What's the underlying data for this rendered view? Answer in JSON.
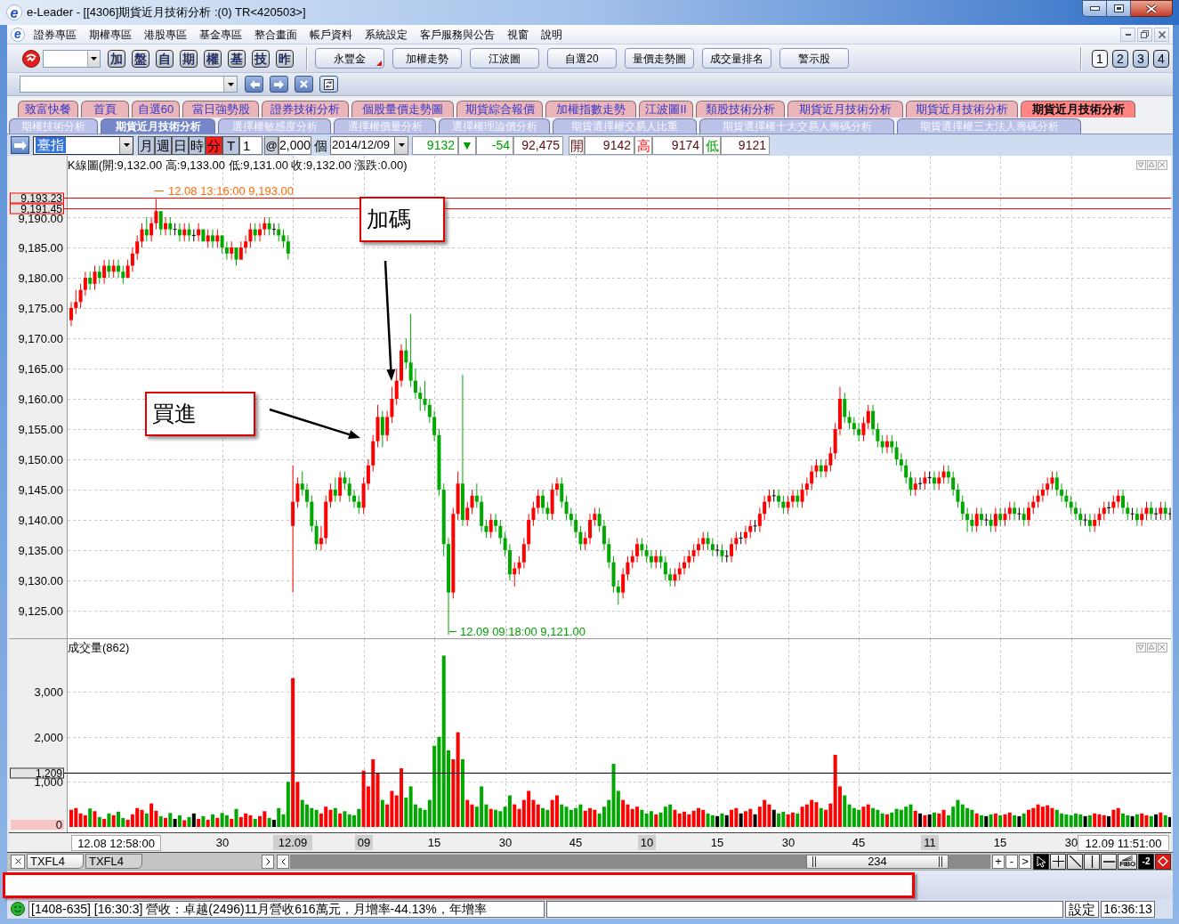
{
  "window": {
    "logo": "e",
    "title": "e-Leader - [[4306]期貨近月技術分析 :(0) TR<420503>]"
  },
  "menu": {
    "logo": "e",
    "items": [
      "證券專區",
      "期權專區",
      "港股專區",
      "基金專區",
      "整合畫面",
      "帳戶資料",
      "系統設定",
      "客戶服務與公告",
      "視窗",
      "說明"
    ]
  },
  "toolbar": {
    "quick_buttons": [
      "加",
      "盤",
      "自",
      "期",
      "權",
      "基",
      "技",
      "昨"
    ],
    "buttons": [
      {
        "label": "永豐金",
        "kind": "menu"
      },
      {
        "label": "加權走勢",
        "kind": "plain"
      },
      {
        "label": "江波圖",
        "kind": "plain"
      },
      {
        "label": "自選20",
        "kind": "plain"
      },
      {
        "label": "量價走勢圖",
        "kind": "plain"
      },
      {
        "label": "成交量排名",
        "kind": "plain"
      },
      {
        "label": "警示股",
        "kind": "plain"
      }
    ],
    "layouts": [
      {
        "label": "1",
        "selected": true
      },
      {
        "label": "2",
        "selected": false
      },
      {
        "label": "3",
        "selected": false
      },
      {
        "label": "4",
        "selected": false
      }
    ]
  },
  "tabs": [
    {
      "label": "致富快餐",
      "selected": false
    },
    {
      "label": "首頁",
      "selected": false
    },
    {
      "label": "自選60",
      "selected": false
    },
    {
      "label": "當日強勢股",
      "selected": false
    },
    {
      "label": "證券技術分析",
      "selected": false
    },
    {
      "label": "個股量價走勢圖",
      "selected": false
    },
    {
      "label": "期貨綜合報價",
      "selected": false
    },
    {
      "label": "加權指數走勢",
      "selected": false
    },
    {
      "label": "江波圖II",
      "selected": false
    },
    {
      "label": "類股技術分析",
      "selected": false
    },
    {
      "label": "期貨近月技術分析",
      "selected": false
    },
    {
      "label": "期貨近月技術分析",
      "selected": false
    },
    {
      "label": "期貨近月技術分析",
      "selected": true
    }
  ],
  "sub_tabs": [
    {
      "label": "期權技術分析",
      "selected": false
    },
    {
      "label": "期貨近月技術分析",
      "selected": true
    },
    {
      "label": "選擇權敏感度分析",
      "selected": false
    },
    {
      "label": "選擇權價量分析",
      "selected": false
    },
    {
      "label": "選擇權理論價分析",
      "selected": false
    },
    {
      "label": "期貨選擇權交易人比重",
      "selected": false
    },
    {
      "label": "期貨選擇權十大交易人籌碼分析",
      "selected": false
    },
    {
      "label": "期貨選擇權三大法人籌碼分析",
      "selected": false
    }
  ],
  "controls": {
    "symbol": "臺指",
    "periods": [
      {
        "label": "月",
        "selected": false
      },
      {
        "label": "週",
        "selected": false
      },
      {
        "label": "日",
        "selected": false
      },
      {
        "label": "時",
        "selected": false
      },
      {
        "label": "分",
        "selected": true
      },
      {
        "label": "T",
        "selected": false
      }
    ],
    "interval": "1",
    "at": "@",
    "count": "2,000",
    "unit": "個",
    "date": "2014/12/09"
  },
  "quote": {
    "down": true,
    "last": "9132",
    "arrow": "▼",
    "change": "-54",
    "volume": "92,475",
    "open_label": "開",
    "open": "9142",
    "high_label": "高",
    "high": "9174",
    "low_label": "低",
    "low": "9121"
  },
  "price_chart": {
    "title": "K線圖(開:9,132.00 高:9,133.00 低:9,131.00 收:9,132.00 漲跌:0.00)",
    "high_marker": "12.08 13:16:00 9,193.00",
    "low_marker": "12.09 09:18:00 9,121.00",
    "callouts": [
      "加碼",
      "買進"
    ],
    "chart_data": {
      "type": "candlestick",
      "grid": true,
      "ylim": [
        9120.3,
        9200.15
      ],
      "yticks": [
        {
          "value": 9190,
          "label": "9,190.00"
        },
        {
          "value": 9185,
          "label": "9,185.00"
        },
        {
          "value": 9180,
          "label": "9,180.00"
        },
        {
          "value": 9175,
          "label": "9,175.00"
        },
        {
          "value": 9170,
          "label": "9,170.00"
        },
        {
          "value": 9165,
          "label": "9,165.00"
        },
        {
          "value": 9160,
          "label": "9,160.00"
        },
        {
          "value": 9155,
          "label": "9,155.00"
        },
        {
          "value": 9150,
          "label": "9,150.00"
        },
        {
          "value": 9145,
          "label": "9,145.00"
        },
        {
          "value": 9140,
          "label": "9,140.00"
        },
        {
          "value": 9135,
          "label": "9,135.00"
        },
        {
          "value": 9130,
          "label": "9,130.00"
        },
        {
          "value": 9125,
          "label": "9,125.00"
        }
      ],
      "ref_lines": [
        {
          "axis": "y",
          "value": 9193.23,
          "label": "9,193.23"
        },
        {
          "axis": "y",
          "value": 9191.45,
          "label": "9,191.45"
        }
      ],
      "ohlc": [
        [
          9173,
          9176,
          9172,
          9175
        ],
        [
          9175,
          9178,
          9174,
          9176
        ],
        [
          9176,
          9179,
          9175,
          9178
        ],
        [
          9178,
          9181,
          9177,
          9180
        ],
        [
          9180,
          9181,
          9178,
          9179
        ],
        [
          9179,
          9182,
          9178,
          9181
        ],
        [
          9181,
          9182,
          9179,
          9180
        ],
        [
          9180,
          9183,
          9179,
          9182
        ],
        [
          9182,
          9183,
          9180,
          9181
        ],
        [
          9181,
          9183,
          9180,
          9182
        ],
        [
          9182,
          9183,
          9180,
          9181
        ],
        [
          9181,
          9182,
          9179,
          9180
        ],
        [
          9180,
          9183,
          9180,
          9182
        ],
        [
          9182,
          9185,
          9181,
          9184
        ],
        [
          9184,
          9187,
          9183,
          9186
        ],
        [
          9186,
          9189,
          9185,
          9188
        ],
        [
          9188,
          9190,
          9186,
          9187
        ],
        [
          9187,
          9190,
          9186,
          9189
        ],
        [
          9189,
          9193,
          9188,
          9191
        ],
        [
          9191,
          9191,
          9187,
          9188
        ],
        [
          9188,
          9190,
          9187,
          9189
        ],
        [
          9189,
          9190,
          9187,
          9188
        ],
        [
          9188,
          9189,
          9187,
          9188
        ],
        [
          9188,
          9189,
          9186,
          9187
        ],
        [
          9187,
          9189,
          9186,
          9188
        ],
        [
          9188,
          9189,
          9186,
          9187
        ],
        [
          9187,
          9188,
          9186,
          9187
        ],
        [
          9187,
          9189,
          9186,
          9188
        ],
        [
          9188,
          9188,
          9186,
          9186
        ],
        [
          9186,
          9188,
          9185,
          9187
        ],
        [
          9187,
          9188,
          9185,
          9186
        ],
        [
          9186,
          9188,
          9185,
          9187
        ],
        [
          9187,
          9187,
          9184,
          9185
        ],
        [
          9185,
          9186,
          9183,
          9184
        ],
        [
          9184,
          9186,
          9183,
          9185
        ],
        [
          9185,
          9185,
          9182,
          9183
        ],
        [
          9183,
          9186,
          9183,
          9185
        ],
        [
          9185,
          9187,
          9184,
          9186
        ],
        [
          9186,
          9189,
          9185,
          9188
        ],
        [
          9188,
          9189,
          9186,
          9187
        ],
        [
          9187,
          9189,
          9186,
          9188
        ],
        [
          9188,
          9190,
          9187,
          9189
        ],
        [
          9189,
          9190,
          9187,
          9188
        ],
        [
          9188,
          9189,
          9187,
          9188
        ],
        [
          9188,
          9189,
          9186,
          9187
        ],
        [
          9187,
          9188,
          9185,
          9186
        ],
        [
          9186,
          9187,
          9183,
          9184
        ],
        [
          9139,
          9149,
          9128,
          9143
        ],
        [
          9143,
          9147,
          9142,
          9146
        ],
        [
          9146,
          9148,
          9144,
          9145
        ],
        [
          9145,
          9146,
          9142,
          9143
        ],
        [
          9143,
          9144,
          9138,
          9139
        ],
        [
          9139,
          9140,
          9135,
          9136
        ],
        [
          9136,
          9139,
          9135,
          9137
        ],
        [
          9137,
          9144,
          9136,
          9143
        ],
        [
          9143,
          9146,
          9142,
          9145
        ],
        [
          9145,
          9147,
          9143,
          9144
        ],
        [
          9144,
          9148,
          9143,
          9147
        ],
        [
          9147,
          9148,
          9145,
          9146
        ],
        [
          9146,
          9147,
          9143,
          9144
        ],
        [
          9144,
          9145,
          9142,
          9143
        ],
        [
          9143,
          9144,
          9141,
          9142
        ],
        [
          9142,
          9147,
          9141,
          9146
        ],
        [
          9146,
          9150,
          9145,
          9149
        ],
        [
          9149,
          9154,
          9148,
          9153
        ],
        [
          9153,
          9159,
          9152,
          9157
        ],
        [
          9157,
          9158,
          9152,
          9154
        ],
        [
          9154,
          9158,
          9153,
          9157
        ],
        [
          9157,
          9162,
          9156,
          9160
        ],
        [
          9160,
          9165,
          9159,
          9163
        ],
        [
          9163,
          9169,
          9162,
          9168
        ],
        [
          9168,
          9170,
          9165,
          9166
        ],
        [
          9166,
          9174,
          9162,
          9163
        ],
        [
          9163,
          9165,
          9160,
          9161
        ],
        [
          9161,
          9162,
          9158,
          9160
        ],
        [
          9160,
          9163,
          9158,
          9159
        ],
        [
          9159,
          9160,
          9156,
          9157
        ],
        [
          9157,
          9158,
          9153,
          9154
        ],
        [
          9154,
          9155,
          9144,
          9145
        ],
        [
          9145,
          9146,
          9134,
          9136
        ],
        [
          9136,
          9137,
          9121,
          9128
        ],
        [
          9128,
          9142,
          9127,
          9141
        ],
        [
          9141,
          9148,
          9140,
          9146
        ],
        [
          9146,
          9164,
          9139,
          9140
        ],
        [
          9140,
          9143,
          9139,
          9142
        ],
        [
          9142,
          9145,
          9141,
          9144
        ],
        [
          9144,
          9146,
          9142,
          9143
        ],
        [
          9143,
          9144,
          9138,
          9139
        ],
        [
          9139,
          9140,
          9137,
          9138
        ],
        [
          9138,
          9141,
          9137,
          9140
        ],
        [
          9140,
          9141,
          9138,
          9139
        ],
        [
          9139,
          9140,
          9136,
          9137
        ],
        [
          9137,
          9138,
          9134,
          9135
        ],
        [
          9135,
          9136,
          9130,
          9131
        ],
        [
          9131,
          9133,
          9129,
          9132
        ],
        [
          9132,
          9134,
          9131,
          9133
        ],
        [
          9133,
          9137,
          9132,
          9136
        ],
        [
          9136,
          9141,
          9135,
          9140
        ],
        [
          9140,
          9143,
          9139,
          9142
        ],
        [
          9142,
          9145,
          9141,
          9144
        ],
        [
          9144,
          9145,
          9141,
          9142
        ],
        [
          9142,
          9143,
          9140,
          9141
        ],
        [
          9141,
          9146,
          9140,
          9145
        ],
        [
          9145,
          9147,
          9144,
          9146
        ],
        [
          9146,
          9147,
          9142,
          9143
        ],
        [
          9143,
          9144,
          9140,
          9141
        ],
        [
          9141,
          9142,
          9139,
          9140
        ],
        [
          9140,
          9141,
          9137,
          9138
        ],
        [
          9138,
          9139,
          9135,
          9136
        ],
        [
          9136,
          9138,
          9135,
          9137
        ],
        [
          9137,
          9141,
          9136,
          9140
        ],
        [
          9140,
          9142,
          9139,
          9141
        ],
        [
          9141,
          9142,
          9138,
          9139
        ],
        [
          9139,
          9140,
          9135,
          9136
        ],
        [
          9136,
          9137,
          9132,
          9133
        ],
        [
          9133,
          9134,
          9128,
          9129
        ],
        [
          9129,
          9130,
          9126,
          9128
        ],
        [
          9128,
          9132,
          9127,
          9131
        ],
        [
          9131,
          9134,
          9130,
          9133
        ],
        [
          9133,
          9135,
          9132,
          9134
        ],
        [
          9134,
          9137,
          9133,
          9136
        ],
        [
          9136,
          9137,
          9134,
          9135
        ],
        [
          9135,
          9136,
          9133,
          9134
        ],
        [
          9134,
          9135,
          9132,
          9133
        ],
        [
          9133,
          9135,
          9132,
          9134
        ],
        [
          9134,
          9135,
          9132,
          9133
        ],
        [
          9133,
          9134,
          9130,
          9131
        ],
        [
          9131,
          9132,
          9129,
          9130
        ],
        [
          9130,
          9132,
          9129,
          9131
        ],
        [
          9131,
          9133,
          9130,
          9132
        ],
        [
          9132,
          9134,
          9131,
          9133
        ],
        [
          9133,
          9135,
          9132,
          9134
        ],
        [
          9134,
          9136,
          9133,
          9135
        ],
        [
          9135,
          9137,
          9134,
          9136
        ],
        [
          9136,
          9138,
          9135,
          9137
        ],
        [
          9137,
          9138,
          9135,
          9136
        ],
        [
          9136,
          9137,
          9134,
          9135
        ],
        [
          9135,
          9136,
          9134,
          9135
        ],
        [
          9135,
          9136,
          9133,
          9134
        ],
        [
          9134,
          9135,
          9133,
          9134
        ],
        [
          9134,
          9137,
          9133,
          9136
        ],
        [
          9136,
          9138,
          9135,
          9137
        ],
        [
          9137,
          9138,
          9136,
          9137
        ],
        [
          9137,
          9139,
          9136,
          9138
        ],
        [
          9138,
          9140,
          9137,
          9139
        ],
        [
          9139,
          9140,
          9138,
          9139
        ],
        [
          9139,
          9142,
          9138,
          9141
        ],
        [
          9141,
          9144,
          9140,
          9143
        ],
        [
          9143,
          9145,
          9142,
          9144
        ],
        [
          9144,
          9145,
          9143,
          9144
        ],
        [
          9144,
          9145,
          9142,
          9143
        ],
        [
          9143,
          9144,
          9141,
          9142
        ],
        [
          9142,
          9144,
          9141,
          9143
        ],
        [
          9143,
          9145,
          9142,
          9144
        ],
        [
          9144,
          9145,
          9142,
          9143
        ],
        [
          9143,
          9146,
          9142,
          9145
        ],
        [
          9145,
          9147,
          9144,
          9146
        ],
        [
          9146,
          9149,
          9145,
          9148
        ],
        [
          9148,
          9150,
          9147,
          9149
        ],
        [
          9149,
          9150,
          9147,
          9148
        ],
        [
          9148,
          9150,
          9147,
          9149
        ],
        [
          9149,
          9152,
          9148,
          9151
        ],
        [
          9151,
          9156,
          9150,
          9155
        ],
        [
          9155,
          9162,
          9154,
          9160
        ],
        [
          9160,
          9161,
          9156,
          9157
        ],
        [
          9157,
          9158,
          9155,
          9156
        ],
        [
          9156,
          9157,
          9154,
          9155
        ],
        [
          9155,
          9156,
          9153,
          9154
        ],
        [
          9154,
          9157,
          9153,
          9156
        ],
        [
          9156,
          9159,
          9155,
          9158
        ],
        [
          9158,
          9159,
          9154,
          9155
        ],
        [
          9155,
          9156,
          9152,
          9153
        ],
        [
          9153,
          9154,
          9151,
          9152
        ],
        [
          9152,
          9154,
          9151,
          9153
        ],
        [
          9153,
          9154,
          9151,
          9152
        ],
        [
          9152,
          9153,
          9149,
          9150
        ],
        [
          9150,
          9151,
          9148,
          9149
        ],
        [
          9149,
          9150,
          9146,
          9147
        ],
        [
          9147,
          9148,
          9144,
          9145
        ],
        [
          9145,
          9147,
          9144,
          9146
        ],
        [
          9146,
          9147,
          9145,
          9146
        ],
        [
          9146,
          9148,
          9145,
          9147
        ],
        [
          9147,
          9148,
          9146,
          9147
        ],
        [
          9147,
          9148,
          9145,
          9146
        ],
        [
          9146,
          9148,
          9145,
          9147
        ],
        [
          9147,
          9149,
          9146,
          9148
        ],
        [
          9148,
          9149,
          9146,
          9147
        ],
        [
          9147,
          9148,
          9144,
          9145
        ],
        [
          9145,
          9146,
          9142,
          9143
        ],
        [
          9143,
          9144,
          9140,
          9141
        ],
        [
          9141,
          9142,
          9138,
          9140
        ],
        [
          9140,
          9141,
          9138,
          9139
        ],
        [
          9139,
          9142,
          9138,
          9141
        ],
        [
          9141,
          9142,
          9139,
          9140
        ],
        [
          9140,
          9141,
          9139,
          9140
        ],
        [
          9140,
          9141,
          9138,
          9139
        ],
        [
          9139,
          9142,
          9138,
          9141
        ],
        [
          9141,
          9142,
          9139,
          9140
        ],
        [
          9140,
          9142,
          9139,
          9141
        ],
        [
          9141,
          9143,
          9140,
          9142
        ],
        [
          9142,
          9143,
          9140,
          9141
        ],
        [
          9141,
          9142,
          9140,
          9141
        ],
        [
          9141,
          9142,
          9139,
          9140
        ],
        [
          9140,
          9143,
          9139,
          9142
        ],
        [
          9142,
          9144,
          9141,
          9143
        ],
        [
          9143,
          9145,
          9142,
          9144
        ],
        [
          9144,
          9146,
          9143,
          9145
        ],
        [
          9145,
          9147,
          9144,
          9146
        ],
        [
          9146,
          9148,
          9145,
          9147
        ],
        [
          9147,
          9148,
          9144,
          9145
        ],
        [
          9145,
          9146,
          9143,
          9144
        ],
        [
          9144,
          9145,
          9142,
          9143
        ],
        [
          9143,
          9144,
          9141,
          9142
        ],
        [
          9142,
          9143,
          9140,
          9141
        ],
        [
          9141,
          9142,
          9139,
          9140
        ],
        [
          9140,
          9141,
          9139,
          9140
        ],
        [
          9140,
          9141,
          9138,
          9139
        ],
        [
          9139,
          9141,
          9138,
          9140
        ],
        [
          9140,
          9142,
          9139,
          9141
        ],
        [
          9141,
          9143,
          9140,
          9142
        ],
        [
          9142,
          9143,
          9141,
          9142
        ],
        [
          9142,
          9144,
          9141,
          9143
        ],
        [
          9143,
          9145,
          9142,
          9144
        ],
        [
          9144,
          9145,
          9141,
          9142
        ],
        [
          9142,
          9143,
          9140,
          9141
        ],
        [
          9141,
          9142,
          9140,
          9141
        ],
        [
          9141,
          9142,
          9139,
          9140
        ],
        [
          9140,
          9142,
          9139,
          9141
        ],
        [
          9141,
          9143,
          9140,
          9142
        ],
        [
          9142,
          9143,
          9140,
          9141
        ],
        [
          9141,
          9142,
          9140,
          9141
        ],
        [
          9141,
          9143,
          9140,
          9142
        ],
        [
          9142,
          9143,
          9140,
          9141
        ],
        [
          9141,
          9142,
          9140,
          9141
        ]
      ]
    }
  },
  "volume_chart": {
    "title": "成交量(862)",
    "chart_data": {
      "type": "bar",
      "grid": true,
      "ylim": [
        0,
        4164
      ],
      "yticks": [
        {
          "value": 3000,
          "label": "3,000"
        },
        {
          "value": 2000,
          "label": "2,000"
        },
        {
          "value": 1000,
          "label": "1,000"
        },
        {
          "value": 0,
          "label": "0"
        }
      ],
      "ref_lines": [
        {
          "axis": "y",
          "value": 1209,
          "label": "1,209"
        }
      ],
      "values": [
        380,
        420,
        300,
        260,
        410,
        350,
        220,
        180,
        300,
        260,
        340,
        200,
        160,
        280,
        420,
        380,
        300,
        520,
        360,
        240,
        200,
        310,
        180,
        260,
        150,
        220,
        300,
        180,
        240,
        160,
        280,
        200,
        310,
        260,
        180,
        400,
        220,
        300,
        260,
        180,
        240,
        350,
        200,
        160,
        420,
        280,
        1000,
        3300,
        1000,
        600,
        500,
        420,
        380,
        300,
        450,
        380,
        420,
        300,
        350,
        280,
        260,
        400,
        1250,
        900,
        1500,
        1200,
        600,
        500,
        800,
        700,
        1300,
        650,
        900,
        500,
        420,
        380,
        600,
        1800,
        2000,
        3800,
        1700,
        1500,
        2100,
        1500,
        600,
        500,
        450,
        900,
        500,
        400,
        380,
        350,
        450,
        700,
        500,
        400,
        600,
        800,
        600,
        500,
        420,
        380,
        600,
        700,
        500,
        450,
        380,
        420,
        500,
        360,
        420,
        380,
        300,
        450,
        600,
        1400,
        800,
        600,
        500,
        400,
        450,
        380,
        300,
        350,
        280,
        320,
        450,
        500,
        380,
        300,
        340,
        280,
        360,
        420,
        380,
        300,
        260,
        240,
        300,
        260,
        380,
        420,
        300,
        350,
        400,
        280,
        450,
        600,
        500,
        380,
        300,
        340,
        280,
        320,
        300,
        450,
        500,
        600,
        550,
        420,
        380,
        520,
        1600,
        900,
        700,
        500,
        420,
        380,
        450,
        500,
        420,
        380,
        300,
        280,
        320,
        400,
        380,
        450,
        500,
        360,
        300,
        260,
        280,
        320,
        300,
        380,
        260,
        450,
        600,
        500,
        420,
        380,
        300,
        260,
        240,
        280,
        300,
        260,
        280,
        320,
        260,
        240,
        300,
        380,
        420,
        500,
        450,
        480,
        420,
        380,
        300,
        280,
        260,
        300,
        280,
        240,
        260,
        300,
        280,
        260,
        240,
        380,
        420,
        300,
        260,
        240,
        280,
        300,
        260,
        240,
        280,
        320,
        260,
        220
      ]
    }
  },
  "x_axis": {
    "start": "12.08 12:58:00",
    "ticks": [
      {
        "label": "30",
        "highlighted": false
      },
      {
        "label": "12.09",
        "highlighted": true
      },
      {
        "label": "09",
        "highlighted": true
      },
      {
        "label": "15",
        "highlighted": false
      },
      {
        "label": "30",
        "highlighted": false
      },
      {
        "label": "45",
        "highlighted": false
      },
      {
        "label": "10",
        "highlighted": true
      },
      {
        "label": "15",
        "highlighted": false
      },
      {
        "label": "30",
        "highlighted": false
      },
      {
        "label": "45",
        "highlighted": false
      },
      {
        "label": "11",
        "highlighted": true
      },
      {
        "label": "15",
        "highlighted": false
      },
      {
        "label": "30",
        "highlighted": false
      }
    ],
    "end": "12.09 11:51:00"
  },
  "sheets": [
    {
      "label": "TXFL4",
      "selected": true
    },
    {
      "label": "TXFL4",
      "selected": false
    }
  ],
  "scroll": {
    "label": "234"
  },
  "zoom_buttons": [
    "+",
    "-",
    ">"
  ],
  "tools": [
    {
      "kind": "pointer",
      "selected": true
    },
    {
      "kind": "crosshair",
      "selected": false
    },
    {
      "kind": "trendline",
      "selected": false
    },
    {
      "kind": "vertical-line",
      "selected": false
    },
    {
      "kind": "horizontal-line",
      "selected": false
    },
    {
      "kind": "fibonacci",
      "label": "FIBO",
      "selected": false
    },
    {
      "kind": "level",
      "label": "-2",
      "selected": false
    },
    {
      "kind": "paint",
      "selected": false
    }
  ],
  "status_bar": {
    "message": "[1408-635] [16:30:3] 營收：卓越(2496)11月營收616萬元，月增率-44.13%，年增率",
    "settings": "設定",
    "clock": "16:36:13"
  }
}
